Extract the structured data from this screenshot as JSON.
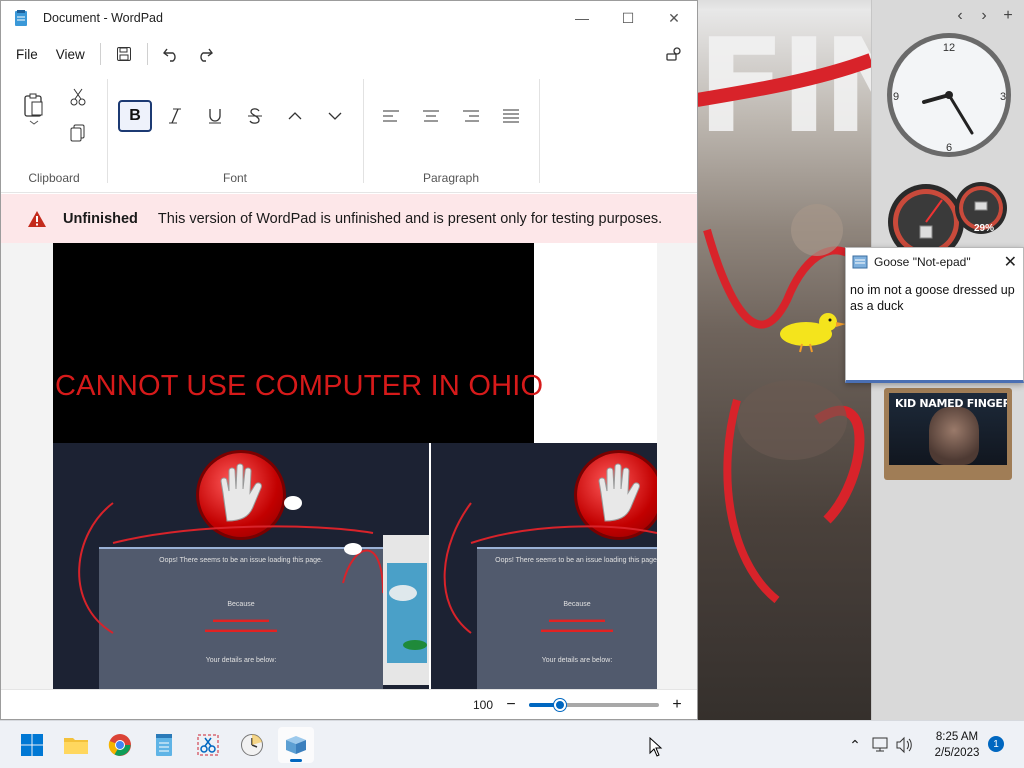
{
  "wordpad": {
    "title": "Document - WordPad",
    "menu": {
      "file": "File",
      "view": "View"
    },
    "ribbon": {
      "groups": {
        "clipboard": "Clipboard",
        "font": "Font",
        "paragraph": "Paragraph"
      },
      "bold_label": "B"
    },
    "infobar": {
      "label": "Unfinished",
      "message": "This version of WordPad is unfinished and is present only for testing purposes."
    },
    "document": {
      "headline": "CANNOT USE COMPUTER IN OHIO",
      "error_lines": [
        "Oops! There seems to be an issue loading this page.",
        "Because",
        "Your details are below:"
      ]
    },
    "status": {
      "zoom": "100",
      "zoom_fraction": 0.24
    }
  },
  "note": {
    "title": "Goose \"Not-epad\"",
    "body": "no im not a goose dressed up as a duck"
  },
  "gadgets": {
    "clock_numbers": {
      "n12": "12",
      "n3": "3",
      "n6": "6",
      "n9": "9"
    },
    "meter_percent": "29%",
    "slideshow_caption": "KID NAMED FINGER"
  },
  "taskbar": {
    "time": "8:25 AM",
    "date": "2/5/2023",
    "notification_count": "1"
  },
  "colors": {
    "accent": "#0067c0",
    "infobar_bg": "#fde7e9",
    "headline_red": "#d61a1a"
  }
}
